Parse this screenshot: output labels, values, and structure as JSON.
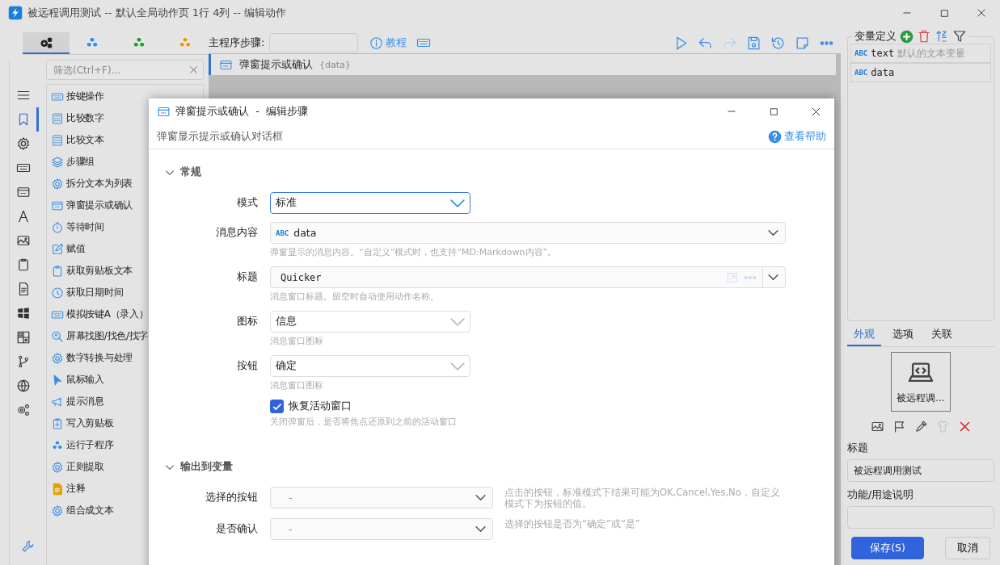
{
  "window": {
    "title": "被远程调用测试 -- 默认全局动作页 1行 4列 -- 编辑动作"
  },
  "left_panel": {
    "tabs": [
      {
        "kind": "gears",
        "selected": true
      },
      {
        "kind": "cubes_blue",
        "selected": false
      },
      {
        "kind": "cubes_green",
        "selected": false
      },
      {
        "kind": "cubes_orange",
        "selected": false
      }
    ],
    "filter": {
      "placeholder": "筛选(Ctrl+F)..."
    },
    "rail": [
      {
        "kind": "menu",
        "selected": false
      },
      {
        "kind": "bookmark",
        "selected": true
      },
      {
        "kind": "gear",
        "selected": false
      },
      {
        "kind": "keyboard",
        "selected": false
      },
      {
        "kind": "window",
        "selected": false
      },
      {
        "kind": "letter",
        "selected": false
      },
      {
        "kind": "image",
        "selected": false
      },
      {
        "kind": "clipboard",
        "selected": false
      },
      {
        "kind": "document",
        "selected": false
      },
      {
        "kind": "windows",
        "selected": false
      },
      {
        "kind": "grid",
        "selected": false
      },
      {
        "kind": "branch",
        "selected": false
      },
      {
        "kind": "globe",
        "selected": false
      },
      {
        "kind": "gears2",
        "selected": false
      }
    ],
    "actions": [
      {
        "kind": "keyboard",
        "label": "按键操作"
      },
      {
        "kind": "calculator",
        "label": "比较数字"
      },
      {
        "kind": "calculator",
        "label": "比较文本"
      },
      {
        "kind": "layers",
        "label": "步骤组"
      },
      {
        "kind": "gear",
        "label": "拆分文本为列表"
      },
      {
        "kind": "window",
        "label": "弹窗提示或确认"
      },
      {
        "kind": "timer",
        "label": "等待时间"
      },
      {
        "kind": "edit",
        "label": "赋值"
      },
      {
        "kind": "clipboard",
        "label": "获取剪贴板文本"
      },
      {
        "kind": "clock",
        "label": "获取日期时间"
      },
      {
        "kind": "keyboard",
        "label": "模拟按键A（录入）"
      },
      {
        "kind": "find",
        "label": "屏幕找图/找色/找字"
      },
      {
        "kind": "gear",
        "label": "数字转换与处理"
      },
      {
        "kind": "cursor",
        "label": "鼠标输入"
      },
      {
        "kind": "megaphone",
        "label": "提示消息"
      },
      {
        "kind": "clipboard_plus",
        "label": "写入剪贴板"
      },
      {
        "kind": "cubes",
        "label": "运行子程序"
      },
      {
        "kind": "gear",
        "label": "正则提取"
      },
      {
        "kind": "note",
        "label": "注释"
      },
      {
        "kind": "gear",
        "label": "组合成文本"
      }
    ]
  },
  "center": {
    "step_label": "主程序步骤:",
    "tutorial": "教程",
    "toolbar": [
      {
        "kind": "play",
        "disabled": false
      },
      {
        "kind": "undo",
        "disabled": false
      },
      {
        "kind": "redo",
        "disabled": true
      },
      {
        "kind": "save",
        "disabled": false
      },
      {
        "kind": "history",
        "disabled": false
      },
      {
        "kind": "note",
        "disabled": false
      },
      {
        "kind": "more",
        "disabled": false
      }
    ],
    "steps": [
      {
        "title": "弹窗提示或确认",
        "param": "{data}",
        "selected": true
      }
    ]
  },
  "right_panel": {
    "title": "变量定义",
    "variables": [
      {
        "type": "ABC",
        "name": "text",
        "description": "默认的文本变量"
      },
      {
        "type": "ABC",
        "name": "data"
      }
    ],
    "tabs": [
      {
        "label": "外观",
        "selected": true
      },
      {
        "label": "选项",
        "selected": false
      },
      {
        "label": "关联",
        "selected": false
      }
    ],
    "preview_label": "被远程调...",
    "tools": [
      {
        "kind": "image",
        "disabled": false
      },
      {
        "kind": "flag",
        "disabled": false
      },
      {
        "kind": "dropper",
        "disabled": false
      },
      {
        "kind": "shirt",
        "disabled": true
      },
      {
        "kind": "delete",
        "disabled": false
      }
    ],
    "title_label": "标题",
    "title_value": "被远程调用测试",
    "desc_label": "功能/用途说明",
    "buttons": [
      {
        "label": "保存(S)",
        "kind": "primary"
      },
      {
        "label": "取消",
        "kind": "normal"
      }
    ]
  },
  "dialog": {
    "title": "弹窗提示或确认  -  编辑步骤",
    "subtitle": "弹窗显示提示或确认对话框",
    "help": "查看帮助",
    "sections": [
      {
        "title": "常规",
        "expanded": true,
        "fields": [
          {
            "kind": "select",
            "label": "模式",
            "value": "标准",
            "focused": true
          },
          {
            "kind": "variable",
            "label": "消息内容",
            "type": "ABC",
            "value": "data",
            "hint": "弹窗显示的消息内容。“自定义”模式时，也支持“MD:Markdown内容”。"
          },
          {
            "kind": "text",
            "label": "标题",
            "value": "Quicker",
            "hint": "消息窗口标题。留空时自动使用动作名称。"
          },
          {
            "kind": "select",
            "label": "图标",
            "value": "信息",
            "focused": false,
            "hint": "消息窗口图标"
          },
          {
            "kind": "select",
            "label": "按钮",
            "value": "确定",
            "focused": false,
            "hint": "消息窗口图标"
          },
          {
            "kind": "checkbox",
            "label": "恢复活动窗口",
            "checked": true,
            "hint": "关闭弹窗后，是否将焦点还原到之前的活动窗口"
          }
        ]
      },
      {
        "title": "输出到变量",
        "expanded": true,
        "fields": [
          {
            "kind": "output",
            "label": "选择的按钮",
            "value": "-",
            "note": "点击的按钮，标准模式下结果可能为OK,Cancel,Yes,No，自定义模式下为按钮的值。"
          },
          {
            "kind": "output",
            "label": "是否确认",
            "value": "-",
            "note": "选择的按钮是否为“确定”或“是”"
          }
        ]
      }
    ]
  }
}
